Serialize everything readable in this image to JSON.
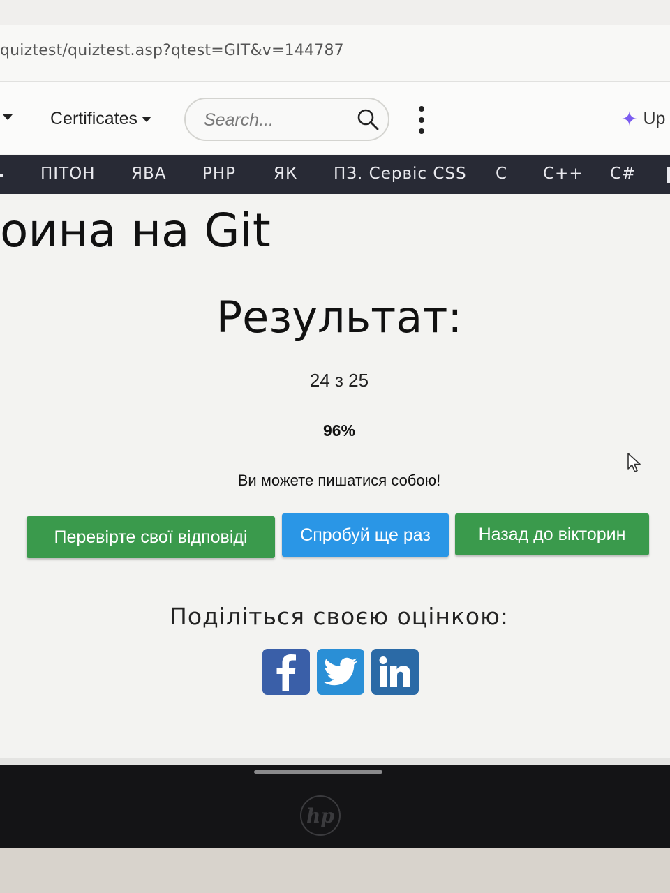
{
  "browser": {
    "url": "quiztest/quiztest.asp?qtest=GIT&v=144787"
  },
  "header": {
    "certificates_label": "Certificates",
    "search_placeholder": "Search...",
    "upgrade_label": "Up",
    "sparkle_icon": "sparkle-icon",
    "search_icon": "search-icon",
    "menu_icon": "kebab-menu-icon"
  },
  "nav": {
    "items": [
      "ПІТОН",
      "ЯВА",
      "PHP",
      "ЯК",
      "ПЗ. Сервіс CSS",
      "C",
      "C++",
      "C#"
    ]
  },
  "main": {
    "page_title": "оина на Git",
    "result_heading": "Результат:",
    "score": "24 з 25",
    "percent": "96%",
    "message": "Ви можете пишатися собою!",
    "buttons": {
      "check_answers": "Перевірте свої відповіді",
      "try_again": "Спробуй ще раз",
      "back_to_quizzes": "Назад до вікторин"
    },
    "share_heading": "Поділіться своєю оцінкою:",
    "social": [
      "facebook-icon",
      "twitter-icon",
      "linkedin-icon"
    ]
  },
  "device": {
    "logo_text": "hp"
  },
  "colors": {
    "nav_bg": "#282a35",
    "green_button": "#3a9a4c",
    "blue_button": "#2a96e6",
    "facebook": "#3a5fa8",
    "twitter": "#2a8fd6",
    "linkedin": "#2b6aa6"
  }
}
